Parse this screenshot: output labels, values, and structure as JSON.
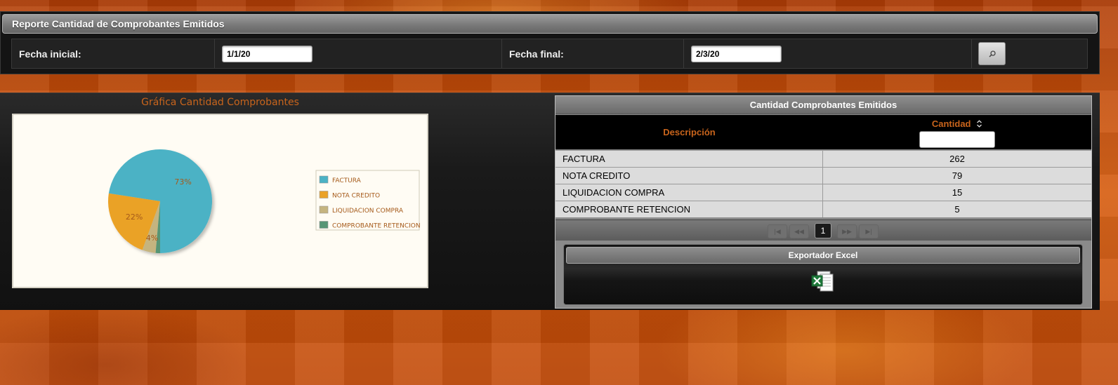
{
  "report": {
    "title": "Reporte Cantidad de Comprobantes Emitidos",
    "fecha_inicial_label": "Fecha inicial:",
    "fecha_inicial_value": "1/1/20",
    "fecha_final_label": "Fecha final:",
    "fecha_final_value": "2/3/20",
    "search_icon": "search-icon"
  },
  "chart": {
    "title": "Gráfica Cantidad Comprobantes"
  },
  "chart_data": {
    "type": "pie",
    "title": "Gráfica Cantidad Comprobantes",
    "categories": [
      "FACTURA",
      "NOTA CREDITO",
      "LIQUIDACION COMPRA",
      "COMPROBANTE RETENCION"
    ],
    "values": [
      262,
      79,
      15,
      5
    ],
    "labels": [
      "73%",
      "22%",
      "4%",
      ""
    ],
    "colors": [
      "#4bb2c5",
      "#eaa228",
      "#c5b47f",
      "#579575"
    ],
    "legend": "right"
  },
  "table": {
    "title": "Cantidad Comprobantes Emitidos",
    "col_descripcion": "Descripción",
    "col_cantidad": "Cantidad",
    "rows": [
      {
        "descripcion": "FACTURA",
        "cantidad": "262"
      },
      {
        "descripcion": "NOTA CREDITO",
        "cantidad": "79"
      },
      {
        "descripcion": "LIQUIDACION COMPRA",
        "cantidad": "15"
      },
      {
        "descripcion": "COMPROBANTE RETENCION",
        "cantidad": "5"
      }
    ],
    "pager": {
      "current_page": "1",
      "first": "|◀",
      "prev": "◀◀",
      "next": "▶▶",
      "last": "▶|"
    }
  },
  "export": {
    "title": "Exportador Excel",
    "icon": "excel-icon"
  }
}
